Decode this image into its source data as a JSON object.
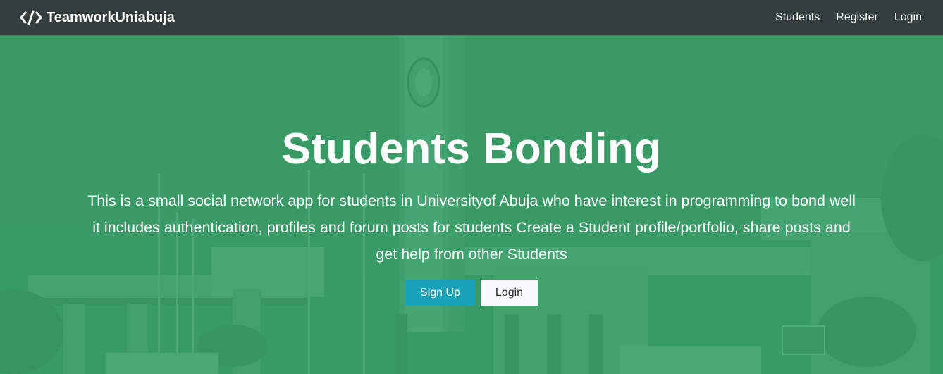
{
  "navbar": {
    "brand": "TeamworkUniabuja",
    "brand_icon": "code-icon",
    "links": [
      {
        "label": "Students"
      },
      {
        "label": "Register"
      },
      {
        "label": "Login"
      }
    ]
  },
  "hero": {
    "title": "Students Bonding",
    "description": "This is a small social network app for students in Universityof Abuja who have interest in programming to bond well it includes authentication, profiles and forum posts for students Create a Student profile/portfolio, share posts and get help from other Students",
    "buttons": {
      "signup": "Sign Up",
      "login": "Login"
    }
  },
  "colors": {
    "navbar_bg": "#343f3d",
    "hero_overlay": "#3d9a68",
    "signup_button": "#17a2b8",
    "login_button": "#f8f9fa"
  }
}
